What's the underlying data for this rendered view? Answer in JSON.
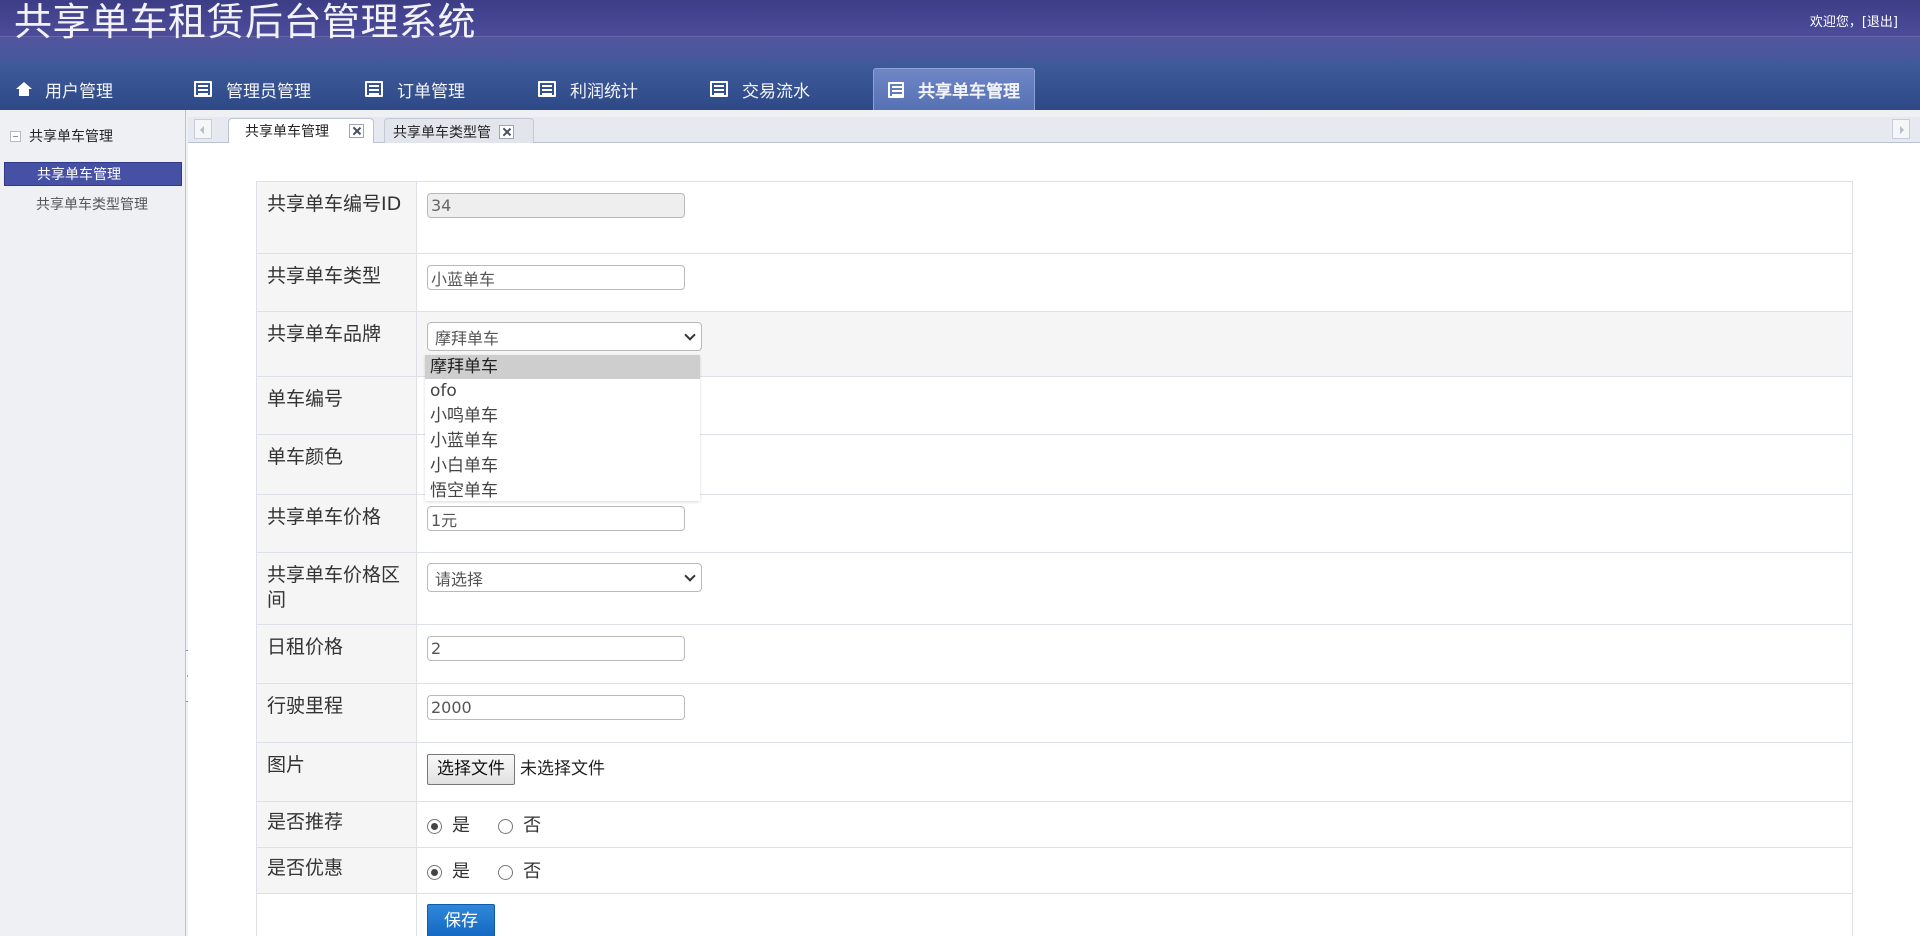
{
  "app": {
    "title": "共享单车租赁后台管理系统",
    "welcome_text": "欢迎您，",
    "logout_label": "[退出]"
  },
  "nav": {
    "tabs": [
      {
        "label": "用户管理",
        "icon": "home-icon"
      },
      {
        "label": "管理员管理",
        "icon": "list-icon"
      },
      {
        "label": "订单管理",
        "icon": "list-icon"
      },
      {
        "label": "利润统计",
        "icon": "list-icon"
      },
      {
        "label": "交易流水",
        "icon": "list-icon"
      },
      {
        "label": "共享单车管理",
        "icon": "list-icon",
        "active": true
      }
    ]
  },
  "sidebar": {
    "section_title": "共享单车管理",
    "items": [
      {
        "label": "共享单车管理",
        "active": true
      },
      {
        "label": "共享单车类型管理"
      }
    ]
  },
  "doc_tabs": [
    {
      "label": "共享单车管理",
      "active": true
    },
    {
      "label": "共享单车类型管"
    }
  ],
  "form": {
    "id_label": "共享单车编号ID",
    "id_value": "34",
    "type_label": "共享单车类型",
    "type_value": "小蓝单车",
    "brand_label": "共享单车品牌",
    "brand_selected": "摩拜单车",
    "brand_options": [
      "摩拜单车",
      "ofo",
      "小鸣单车",
      "小蓝单车",
      "小白单车",
      "悟空单车"
    ],
    "bike_no_label": "单车编号",
    "color_label": "单车颜色",
    "price_label": "共享单车价格",
    "price_value": "1元",
    "price_range_label": "共享单车价格区间",
    "price_range_selected": "请选择",
    "daily_price_label": "日租价格",
    "daily_price_value": "2",
    "mileage_label": "行驶里程",
    "mileage_value": "2000",
    "image_label": "图片",
    "file_button": "选择文件",
    "file_status": "未选择文件",
    "recommend_label": "是否推荐",
    "discount_label": "是否优惠",
    "yes_label": "是",
    "no_label": "否",
    "recommend_value": "是",
    "discount_value": "是",
    "save_label": "保存"
  },
  "colors": {
    "header_bg": "#45458f",
    "nav_bg": "#34508f",
    "sidebar_active": "#4651a6",
    "save_button": "#1f77cf"
  }
}
